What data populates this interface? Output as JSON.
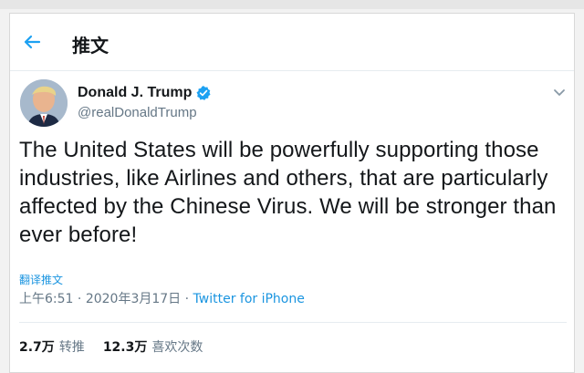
{
  "header": {
    "title": "推文"
  },
  "tweet": {
    "display_name": "Donald J. Trump",
    "handle": "@realDonaldTrump",
    "text": "The United States will be powerfully supporting those industries, like Airlines and others, that are particularly affected by the Chinese Virus. We will be stronger than ever before!",
    "translate_label": "翻译推文",
    "time": "上午6:51",
    "separator": "·",
    "date": "2020年3月17日",
    "source": "Twitter for iPhone"
  },
  "stats": {
    "retweets_count": "2.7万",
    "retweets_label": "转推",
    "likes_count": "12.3万",
    "likes_label": "喜欢次数"
  },
  "colors": {
    "accent": "#1da1f2",
    "link": "#1b95e0",
    "secondary": "#657786"
  },
  "icons": {
    "back": "left-arrow-icon",
    "verified": "verified-badge-icon",
    "more": "chevron-down-icon"
  }
}
